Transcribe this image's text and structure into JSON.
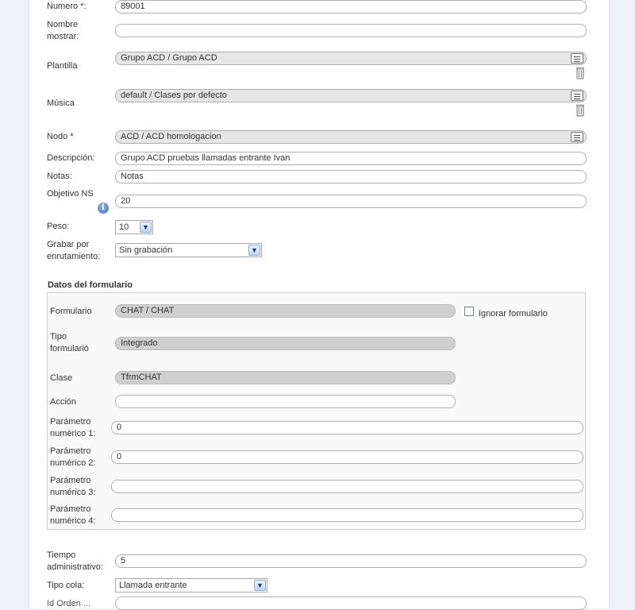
{
  "fields": {
    "numero": {
      "label": "Numero *:",
      "value": "89001"
    },
    "nombre_mostrar": {
      "label": "Nombre mostrar:",
      "value": ""
    },
    "plantilla": {
      "label": "Plantilla",
      "value": "Grupo ACD / Grupo ACD"
    },
    "musica": {
      "label": "Música",
      "value": "default / Clases por defecto"
    },
    "nodo": {
      "label": "Nodo *",
      "value": "ACD / ACD homologacion"
    },
    "descripcion": {
      "label": "Descripción:",
      "value": "Grupo ACD pruebas llamadas entrante Ivan"
    },
    "notas": {
      "label": "Notas:",
      "value": "Notas"
    },
    "objetivo_ns": {
      "label": "Objetivo NS",
      "value": "20",
      "info_icon": "i"
    },
    "peso": {
      "label": "Peso:",
      "value": "10"
    },
    "grabar": {
      "label": "Grabar por enrutamiento:",
      "value": "Sin grabación"
    }
  },
  "formulario": {
    "title": "Datos del formulario",
    "formulario": {
      "label": "Formulario",
      "value": "CHAT / CHAT"
    },
    "ignorar": {
      "label": "Ignorar formulario",
      "checked": false
    },
    "tipo": {
      "label": "Tipo formulario",
      "value": "Integrado"
    },
    "clase": {
      "label": "Clase",
      "value": "TfrmCHAT"
    },
    "accion": {
      "label": "Acción",
      "value": ""
    },
    "p1": {
      "label": "Parámetro numérico 1:",
      "value": "0"
    },
    "p2": {
      "label": "Parámetro numérico 2:",
      "value": "0"
    },
    "p3": {
      "label": "Parámetro numérico 3:",
      "value": ""
    },
    "p4": {
      "label": "Parámetro numérico 4:",
      "value": ""
    }
  },
  "extra": {
    "tiempo_admin": {
      "label": "Tiempo administrativo:",
      "value": "5"
    },
    "tipo_cola": {
      "label": "Tipo cola:",
      "value": "Llamada entrante"
    },
    "next_label": "Id Orden ..."
  }
}
